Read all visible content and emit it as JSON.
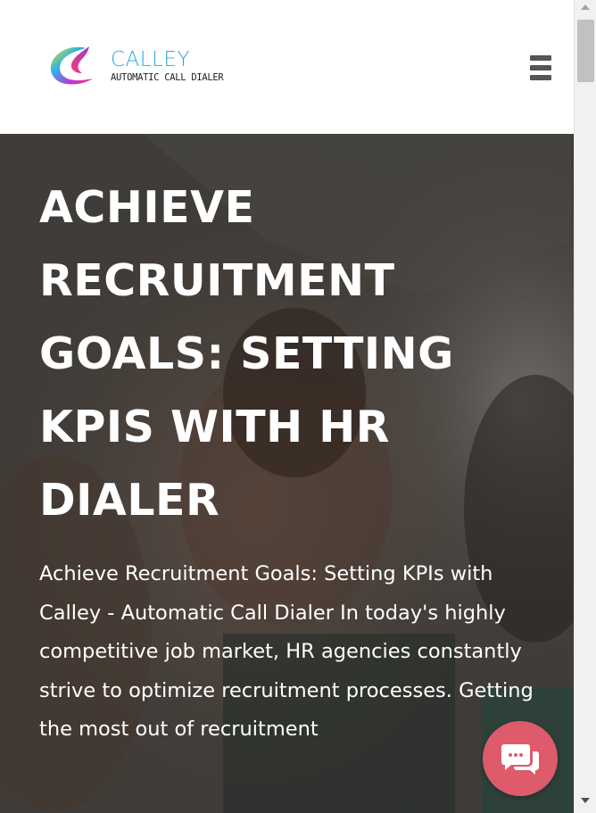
{
  "header": {
    "logo_name": "CALLEY",
    "logo_tagline": "AUTOMATIC CALL DIALER",
    "menu_icon": "hamburger-menu-icon"
  },
  "hero": {
    "title": "ACHIEVE RECRUITMENT GOALS: SETTING KPIS WITH HR DIALER",
    "intro": "Achieve Recruitment Goals: Setting KPIs with Calley - Automatic Call Dialer In today's highly competitive job market, HR agencies constantly strive to optimize recruitment processes. Getting the most out of recruitment"
  },
  "chat": {
    "icon": "chat-bubble-icon",
    "color": "#dd5b6a"
  },
  "colors": {
    "brand_blue": "#2aa9e0",
    "menu_gray": "#555555"
  }
}
